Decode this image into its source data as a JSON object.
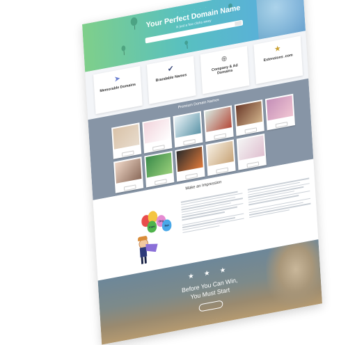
{
  "hero": {
    "title": "Your Perfect Domain Name",
    "subtitle": "is just a few clicks away",
    "search_placeholder": "",
    "search_button": "",
    "nav_dots": "· · · · · ·"
  },
  "features": [
    {
      "icon": "paper-plane-icon",
      "glyph": "➤",
      "title": "Memorable Domains",
      "color": "#6a7fd0"
    },
    {
      "icon": "checkmark-circle-icon",
      "glyph": "✔",
      "title": "Brandable Names",
      "color": "#3b4a7a"
    },
    {
      "icon": "plus-circle-icon",
      "glyph": "⊕",
      "title": "Company & Ad Domains",
      "color": "#777777"
    },
    {
      "icon": "star-icon",
      "glyph": "★",
      "title": "Extensions .com",
      "color": "#c9a02f"
    }
  ],
  "domains": {
    "heading": "Premium Domain Names",
    "subheading": "",
    "row1": [
      "",
      "",
      "",
      "",
      "",
      ""
    ],
    "row2": [
      "",
      "",
      "",
      "",
      ""
    ]
  },
  "why": {
    "heading": "Make an Impression",
    "subheading": "",
    "col1_title": "",
    "col2_title": "",
    "balloons": [
      "Com",
      "Org",
      "Net"
    ]
  },
  "cta": {
    "stars": "★ ★ ★",
    "line1": "Before You Can Win,",
    "line2": "You Must Start",
    "button": "",
    "pager": "· · · · · ·"
  }
}
